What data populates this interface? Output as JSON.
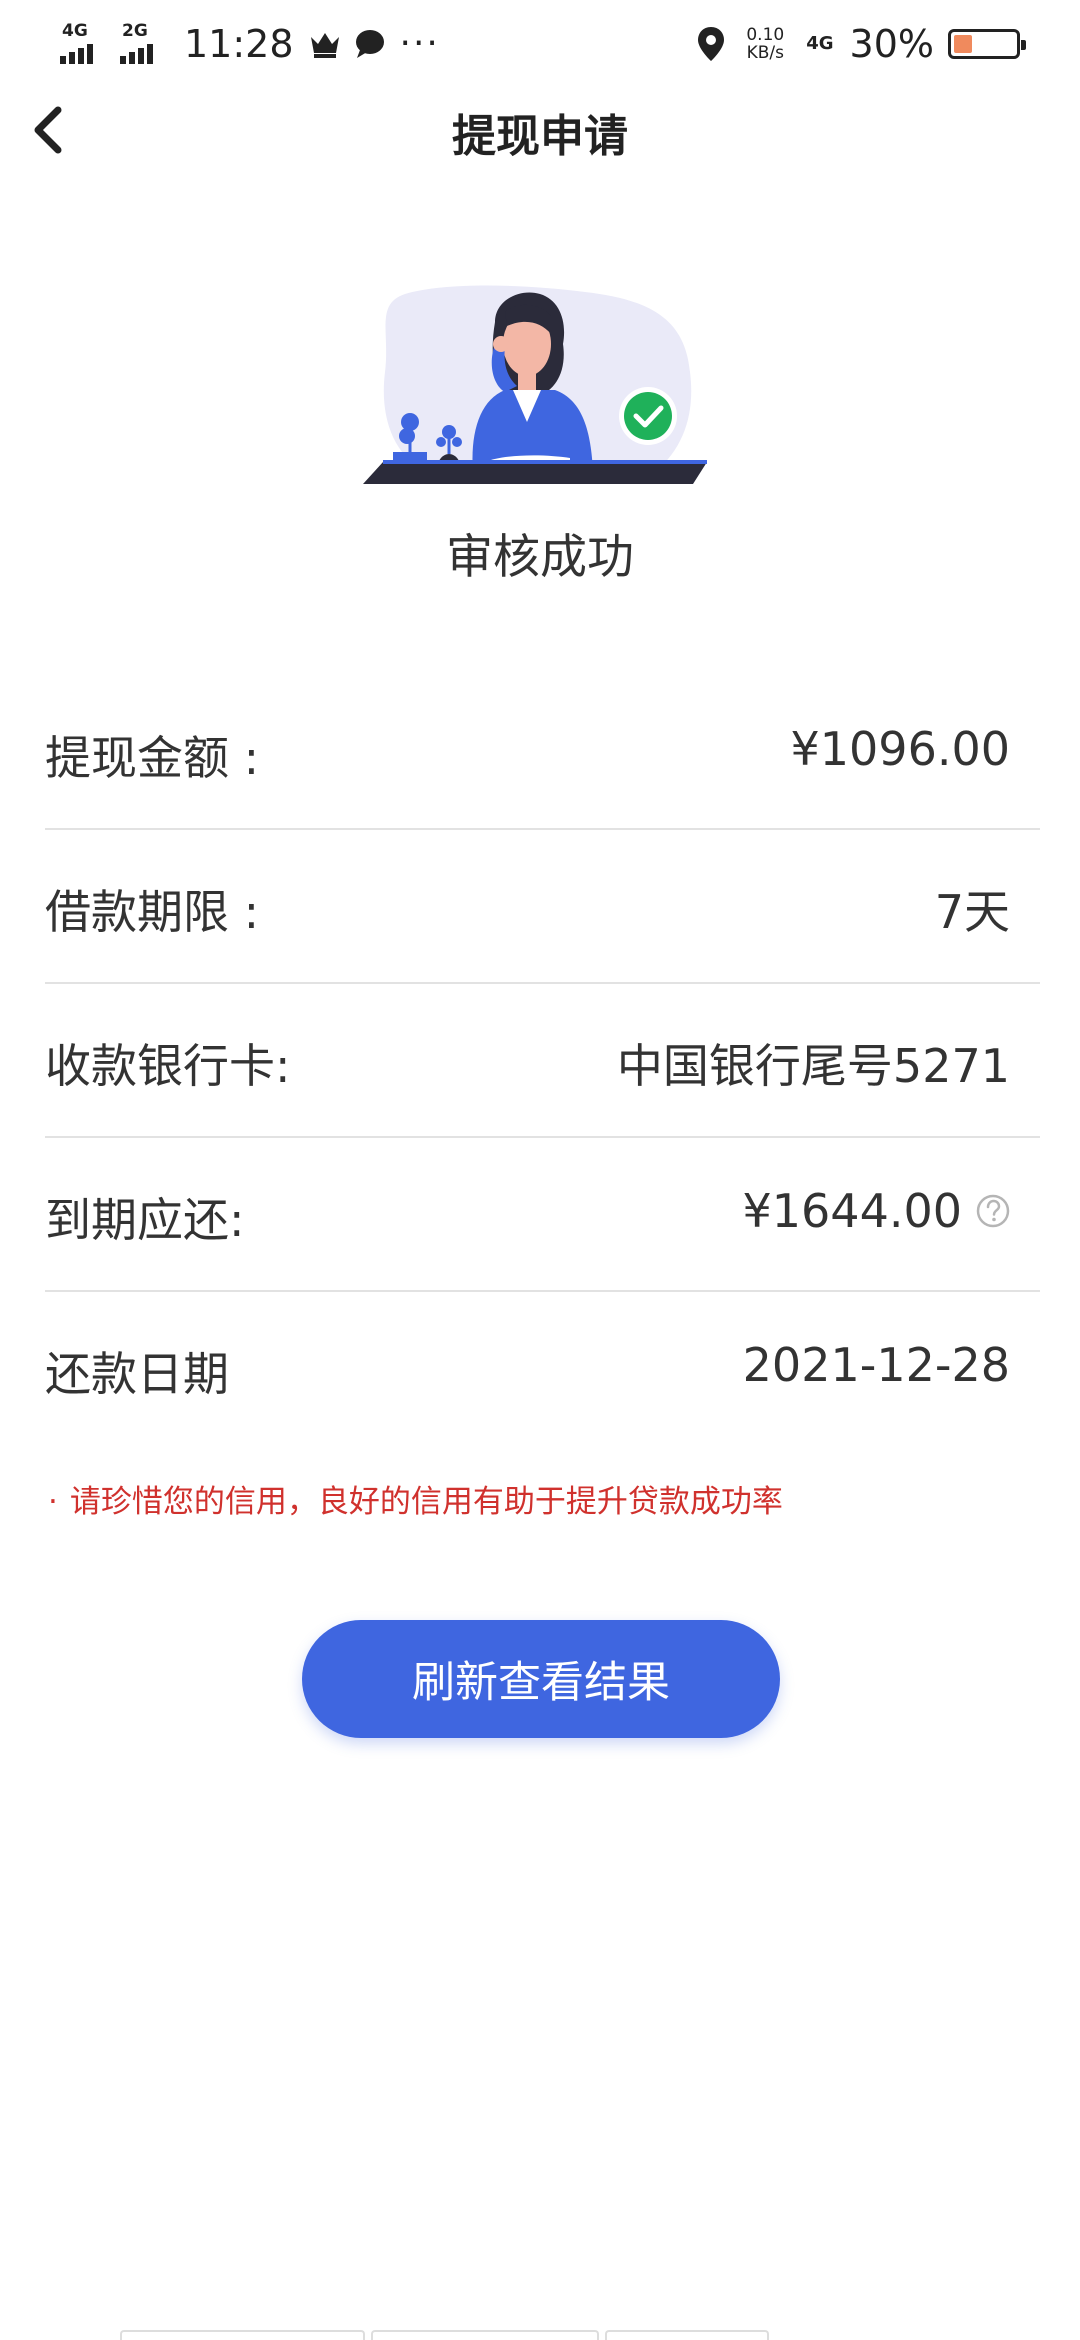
{
  "status_bar": {
    "net1": "4G",
    "net2": "2G",
    "time": "11:28",
    "speed_value": "0.10",
    "speed_unit": "KB/s",
    "net3": "4G",
    "battery_percent": "30%",
    "battery_level": 0.3,
    "icons": [
      "crown-icon",
      "chat-bubble-icon",
      "more-dots-icon",
      "location-pin-icon",
      "battery-icon"
    ]
  },
  "nav": {
    "title": "提现申请",
    "back_icon": "chevron-left-icon"
  },
  "review": {
    "status_text": "审核成功",
    "illustration": "woman-at-desk-with-checkmark",
    "badge_color": "#1fb15a"
  },
  "details": [
    {
      "label": "提现金额 :",
      "value": "¥1096.00"
    },
    {
      "label": "借款期限 :",
      "value": "7天"
    },
    {
      "label": "收款银行卡:",
      "value": "中国银行尾号5271"
    },
    {
      "label": "到期应还:",
      "value": "¥1644.00"
    },
    {
      "label": "还款日期",
      "value": "2021-12-28"
    }
  ],
  "notice": {
    "bullet": "·",
    "text": "请珍惜您的信用，良好的信用有助于提升贷款成功率"
  },
  "actions": {
    "refresh_label": "刷新查看结果"
  },
  "colors": {
    "primary": "#3f66e0",
    "notice": "#d0312d",
    "divider": "#e2e2e2"
  }
}
